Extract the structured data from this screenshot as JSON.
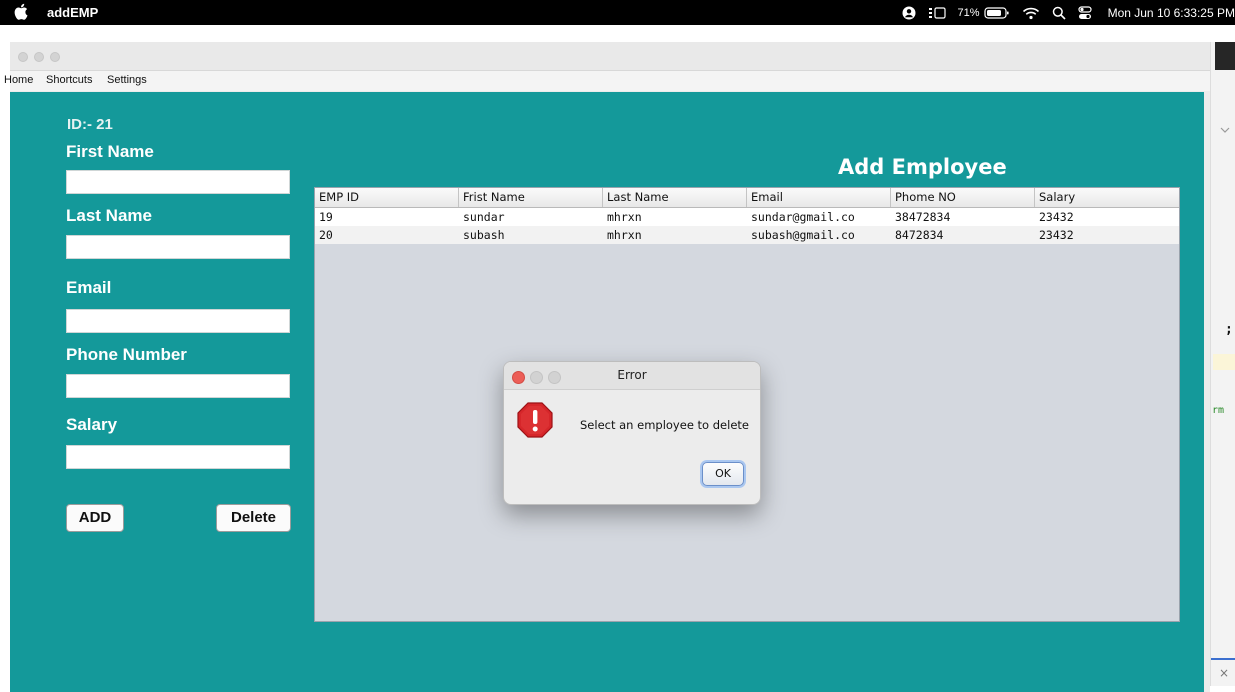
{
  "menubar": {
    "app_name": "addEMP",
    "battery": "71%",
    "clock": "Mon Jun 10  6:33:25 PM"
  },
  "window": {
    "menu": [
      "Home",
      "Shortcuts",
      "Settings"
    ]
  },
  "form": {
    "id_label": "ID:- 21",
    "first_name_label": "First Name",
    "last_name_label": "Last Name",
    "email_label": "Email",
    "phone_label": "Phone Number",
    "salary_label": "Salary",
    "first_name_value": "",
    "last_name_value": "",
    "email_value": "",
    "phone_value": "",
    "salary_value": "",
    "add_label": "ADD",
    "delete_label": "Delete"
  },
  "heading": "Add Employee",
  "table": {
    "columns": [
      "EMP ID",
      "Frist Name",
      "Last Name",
      "Email",
      "Phome NO",
      "Salary"
    ],
    "rows": [
      [
        "19",
        "sundar",
        "mhrxn",
        "sundar@gmail.co",
        "38472834",
        "23432"
      ],
      [
        "20",
        "subash",
        "mhrxn",
        "subash@gmail.co",
        "8472834",
        "23432"
      ]
    ]
  },
  "dialog": {
    "title": "Error",
    "message": "Select an employee to delete",
    "ok_label": "OK"
  },
  "side": {
    "chars": [
      ";",
      "rm"
    ]
  },
  "colors": {
    "content_bg": "#14999a",
    "table_bg": "#d4d8df",
    "error_icon": "#d6262a"
  }
}
